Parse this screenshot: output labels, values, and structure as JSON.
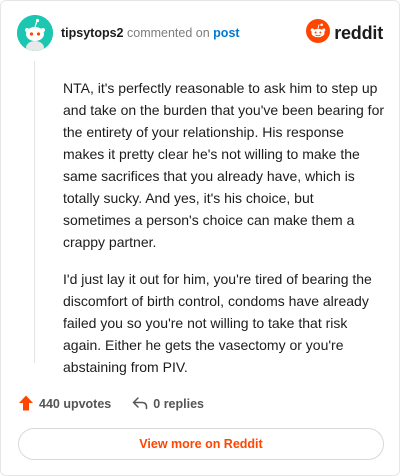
{
  "header": {
    "username": "tipsytops2",
    "action_text": "commented on",
    "post_link": "post",
    "brand_name": "reddit"
  },
  "comment": {
    "paragraphs": [
      "NTA, it's perfectly reasonable to ask him to step up and take on the burden that you've been bearing for the entirety of your relationship. His response makes it pretty clear he's not willing to make the same sacrifices that you already have, which is totally sucky. And yes, it's his choice, but sometimes a person's choice can make them a crappy partner.",
      "I'd just lay it out for him, you're tired of bearing the discomfort of birth control, condoms have already failed you so you're not willing to take that risk again. Either he gets the vasectomy or you're abstaining from PIV."
    ]
  },
  "actions": {
    "upvotes": "440 upvotes",
    "replies": "0 replies"
  },
  "footer": {
    "view_more": "View more on Reddit"
  },
  "colors": {
    "accent": "#ff4500",
    "avatar_bg": "#1bc7b0",
    "link": "#0079d3"
  },
  "icons": [
    "snoo-avatar-icon",
    "reddit-logo-icon",
    "upvote-arrow-icon",
    "reply-arrow-icon"
  ]
}
